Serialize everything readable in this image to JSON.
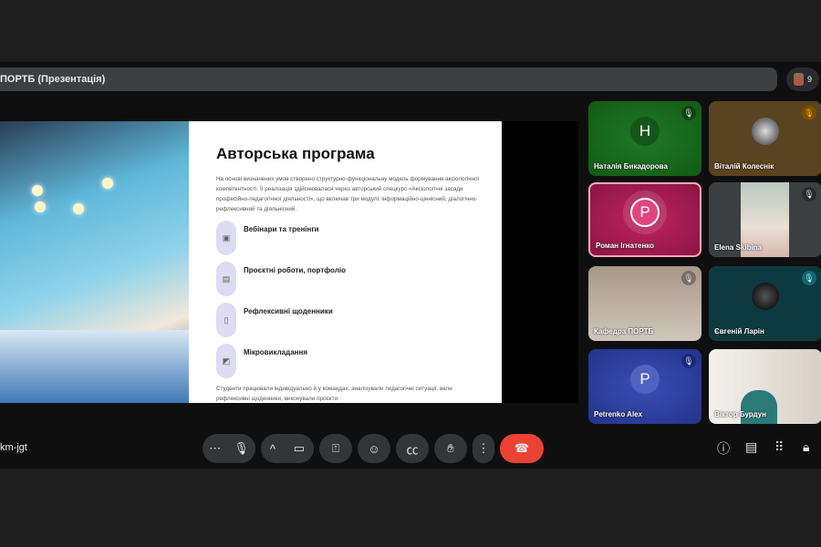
{
  "meeting": {
    "title": "ПОРТБ (Презентація)",
    "participant_count": "9",
    "code": "km-jgt"
  },
  "slide": {
    "title": "Авторська програма",
    "intro": "На основі визначених умов створено структурно-функціональну модель формування аксіологічної компетентності. Її реалізація здійснювалася через авторський спецкурс «Аксіологічні засади професійно-педагогічної діяльності», що включав три модулі: інформаційно-ціннісний, діалогічно-рефлексивний та діяльнісний.",
    "items": [
      {
        "label": "Вебінари та тренінги",
        "icon": "presentation-icon"
      },
      {
        "label": "Проєктні роботи, портфоліо",
        "icon": "monitor-icon"
      },
      {
        "label": "Рефлексивні щоденники",
        "icon": "journal-icon"
      },
      {
        "label": "Мікровикладання",
        "icon": "teach-icon"
      }
    ],
    "footer": "Студенти працювали індивідуально й у командах, аналізували педагогічні ситуації, вели рефлексивні щоденники, виконували проєкти."
  },
  "participants": [
    {
      "name": "Наталія Бикадорова",
      "initial": "Н",
      "bg": "#1e6b22"
    },
    {
      "name": "Віталій Колеснік",
      "bg": "#5a4320"
    },
    {
      "name": "Роман Ігнатенко",
      "initial": "Р",
      "bg": "#a3184f"
    },
    {
      "name": "Elena Skibina",
      "bg": "#3c4043"
    },
    {
      "name": "Кафедра ПОРТБ",
      "bg": "#9a8a78"
    },
    {
      "name": "Євгеній Ларін",
      "bg": "#0e3a3f"
    },
    {
      "name": "Petrenko Alex",
      "initial": "P",
      "bg": "#2d3e9a"
    },
    {
      "name": "Віктор Бурдун",
      "bg": "#d8d2c8"
    }
  ],
  "colors": {
    "end_call": "#ea4335"
  }
}
